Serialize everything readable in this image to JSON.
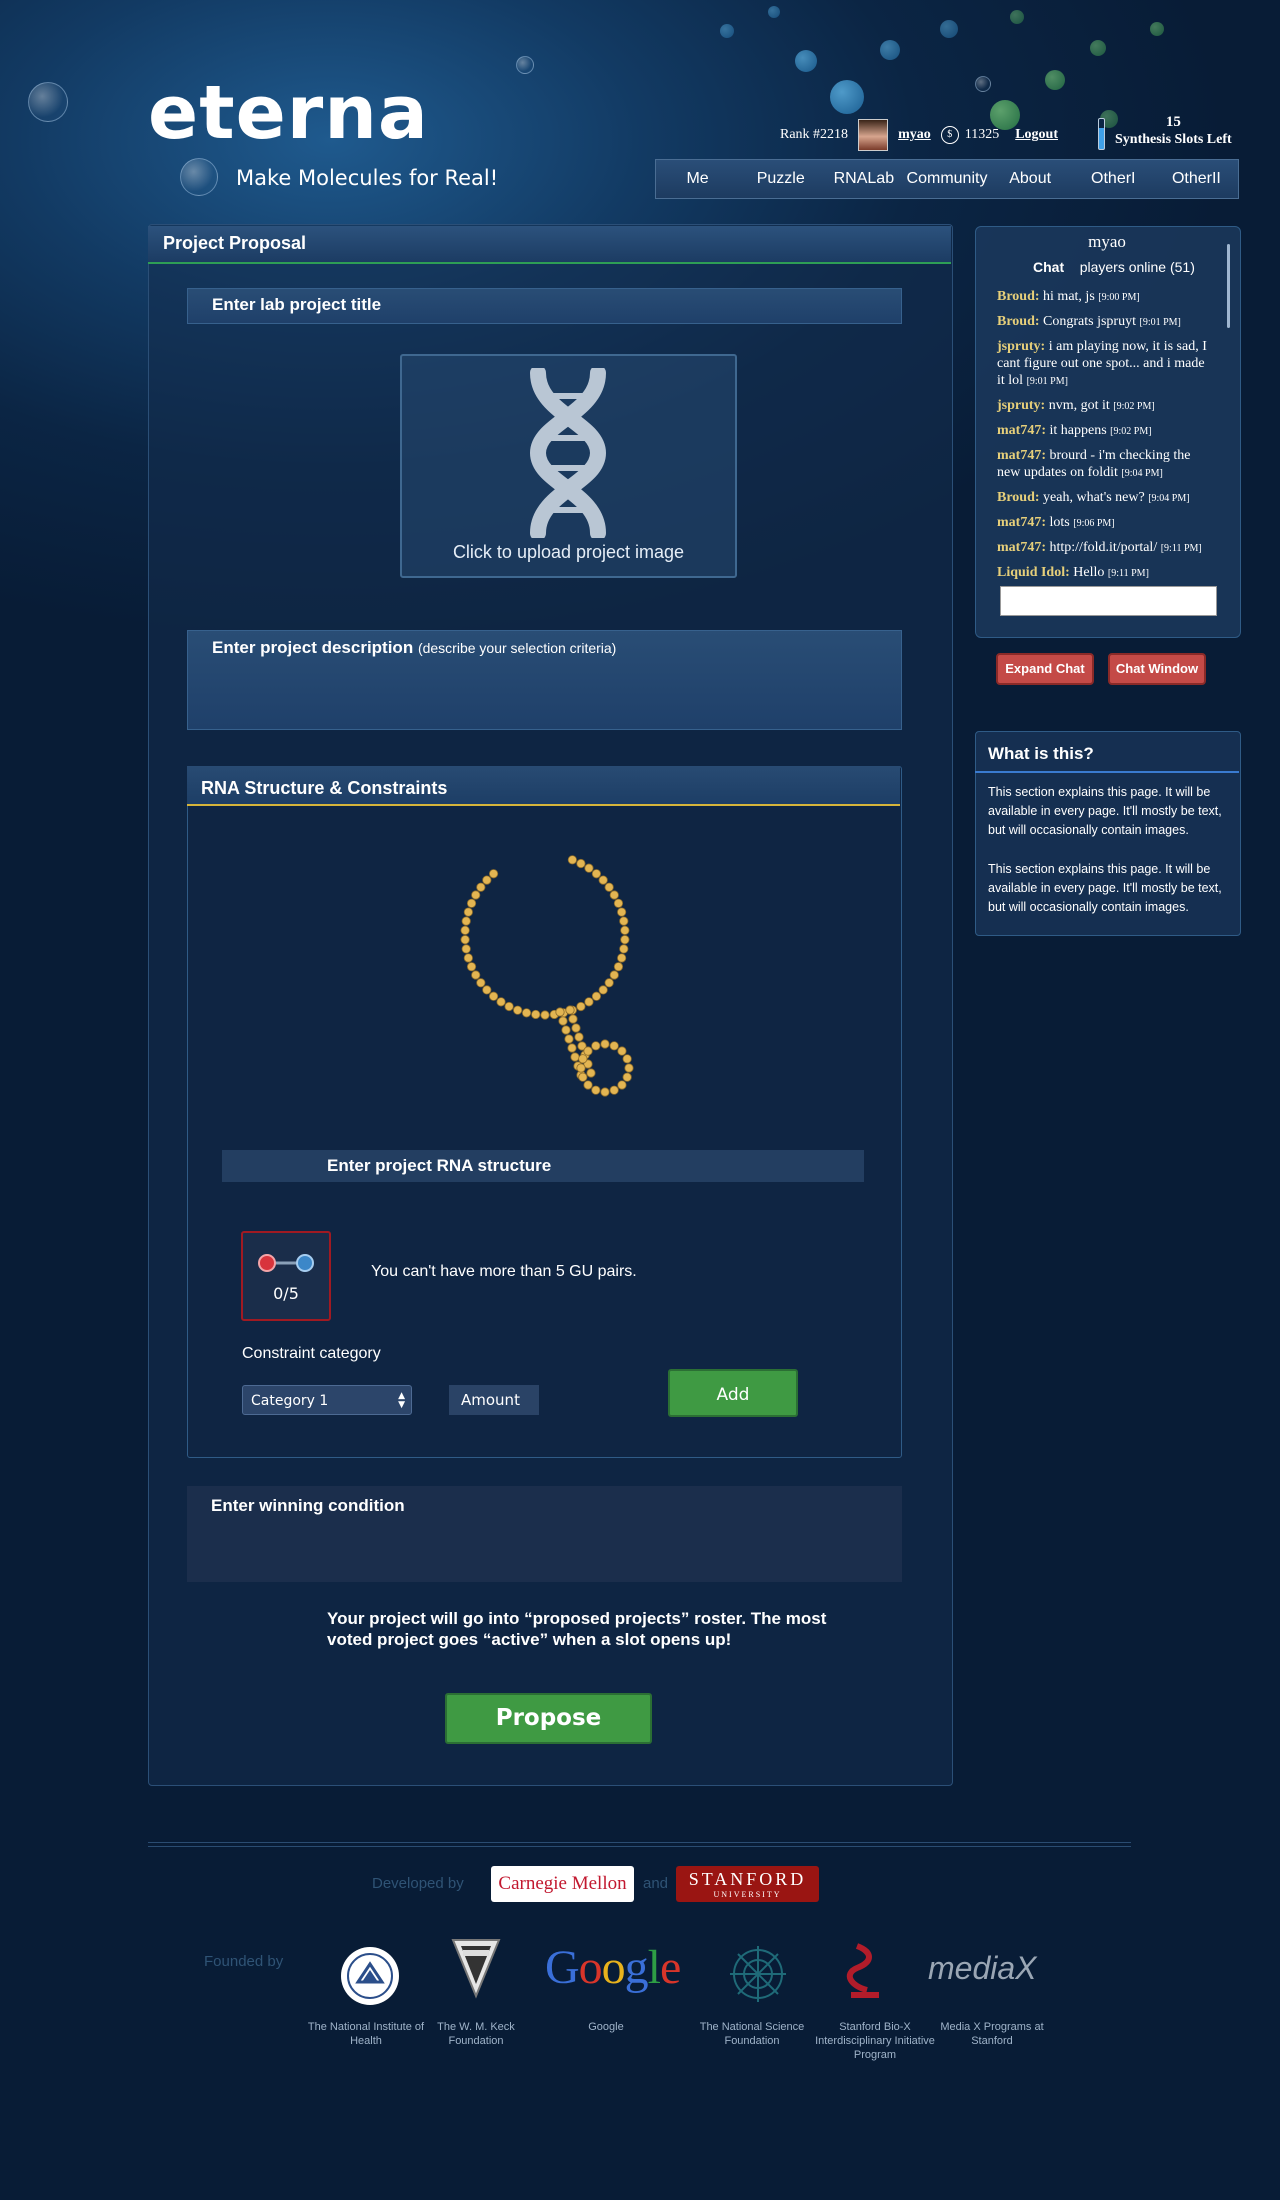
{
  "header": {
    "logo": "eterna",
    "tagline": "Make Molecules for Real!",
    "rank": "Rank #2218",
    "username": "myao",
    "coin_symbol": "$",
    "points": "11325",
    "logout": "Logout",
    "slots_count": "15",
    "slots_label": "Synthesis Slots Left"
  },
  "nav": [
    "Me",
    "Puzzle",
    "RNALab",
    "Community",
    "About",
    "OtherI",
    "OtherII"
  ],
  "proposal": {
    "title": "Project Proposal",
    "lab_title_label": "Enter lab project title",
    "upload_text": "Click to upload project image",
    "description_label": "Enter project description",
    "description_hint": "(describe your selection criteria)",
    "rna_section_title": "RNA Structure & Constraints",
    "rna_structure_label": "Enter project RNA structure",
    "gu_count": "0/5",
    "gu_message": "You can't have more than 5 GU pairs.",
    "constraint_label": "Constraint category",
    "category_value": "Category 1",
    "amount_label": "Amount",
    "add_label": "Add",
    "winning_label": "Enter winning condition",
    "roster_message": "Your project will go into “proposed projects” roster. The most voted project goes “active” when a slot opens up!",
    "propose_label": "Propose"
  },
  "chat": {
    "user": "myao",
    "tab": "Chat",
    "online": "players online (51)",
    "messages": [
      {
        "user": "Broud:",
        "text": "hi mat, js",
        "time": "[9:00 PM]"
      },
      {
        "user": "Broud:",
        "text": "Congrats jspruyt",
        "time": "[9:01 PM]"
      },
      {
        "user": "jspruty:",
        "text": "i am playing now, it is sad, I cant figure out one spot... and i made it lol",
        "time": "[9:01 PM]"
      },
      {
        "user": "jspruty:",
        "text": "nvm, got it",
        "time": "[9:02 PM]"
      },
      {
        "user": "mat747:",
        "text": "it happens",
        "time": "[9:02 PM]"
      },
      {
        "user": "mat747:",
        "text": "brourd - i'm checking the new updates on foldit",
        "time": "[9:04 PM]"
      },
      {
        "user": "Broud:",
        "text": "yeah, what's new?",
        "time": "[9:04 PM]"
      },
      {
        "user": "mat747:",
        "text": "lots",
        "time": "[9:06 PM]"
      },
      {
        "user": "mat747:",
        "text": "http://fold.it/portal/",
        "time": "[9:11 PM]"
      },
      {
        "user": "Liquid Idol:",
        "text": "Hello",
        "time": "[9:11 PM]"
      }
    ],
    "expand_label": "Expand Chat",
    "window_label": "Chat Window"
  },
  "what_is_this": {
    "title": "What is this?",
    "p1": "This section explains this page. It will be available in every page. It'll mostly be text, but will occasionally contain images.",
    "p2": "This section explains this page. It will be available in every page. It'll mostly be text, but will occasionally contain images."
  },
  "footer": {
    "developed_by": "Developed by",
    "cmu": "Carnegie Mellon",
    "and": "and",
    "stanford": "STANFORD",
    "stanford_sub": "UNIVERSITY",
    "founded_by": "Founded by",
    "sponsors": [
      {
        "name": "The National Institute of Health",
        "icon": "nih-seal-icon"
      },
      {
        "name": "The W. M. Keck Foundation",
        "icon": "keck-logo-icon"
      },
      {
        "name": "Google",
        "icon": "google-logo"
      },
      {
        "name": "The National Science Foundation",
        "icon": "nsf-logo-icon"
      },
      {
        "name": "Stanford Bio-X Interdisciplinary Initiative Program",
        "icon": "biox-logo-icon"
      },
      {
        "name": "Media X Programs at Stanford",
        "icon": "mediax-logo"
      }
    ],
    "google_logo_text": "Google",
    "mediax_logo_text": "mediaX"
  },
  "colors": {
    "accent_green": "#3f9a43",
    "accent_red": "#c44a47",
    "chat_user": "#e6cf7a",
    "rna_underline": "#d6b43a"
  }
}
